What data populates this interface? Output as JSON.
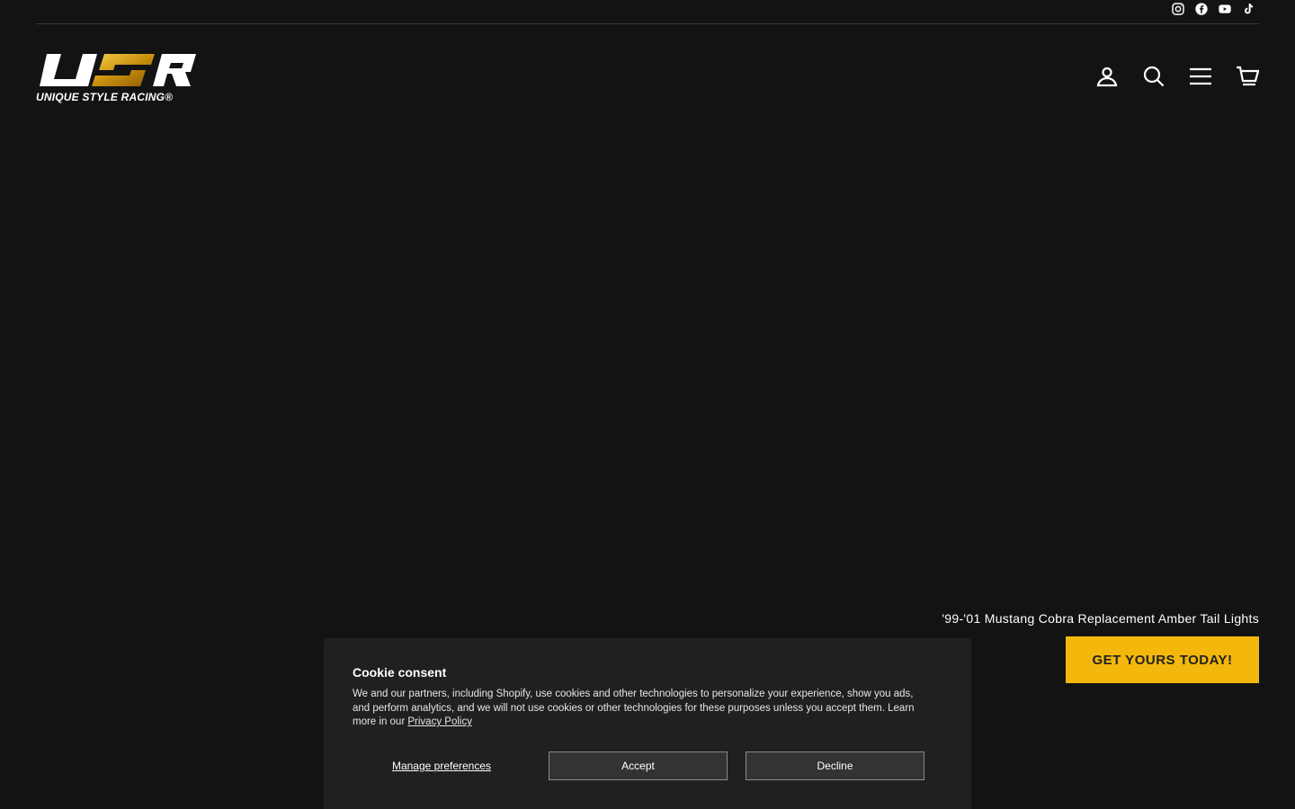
{
  "brand": {
    "logo_mark": "USR",
    "logo_text": "UNIQUE STYLE RACING®",
    "accent_color": "#f3b80b"
  },
  "social": [
    {
      "icon": "instagram-icon"
    },
    {
      "icon": "facebook-icon"
    },
    {
      "icon": "youtube-icon"
    },
    {
      "icon": "tiktok-icon"
    }
  ],
  "header": {
    "icons": [
      "account-icon",
      "search-icon",
      "menu-icon",
      "cart-icon"
    ]
  },
  "hero": {
    "caption": "'99-'01 Mustang Cobra Replacement Amber Tail Lights",
    "cta_label": "GET YOURS TODAY!"
  },
  "cookie": {
    "title": "Cookie consent",
    "text": "We and our partners, including Shopify, use cookies and other technologies to personalize your experience, show you ads, and perform analytics, and we will not use cookies or other technologies for these purposes unless you accept them. Learn more in our",
    "link_label": "Privacy Policy",
    "manage_label": "Manage preferences",
    "accept_label": "Accept",
    "decline_label": "Decline"
  }
}
